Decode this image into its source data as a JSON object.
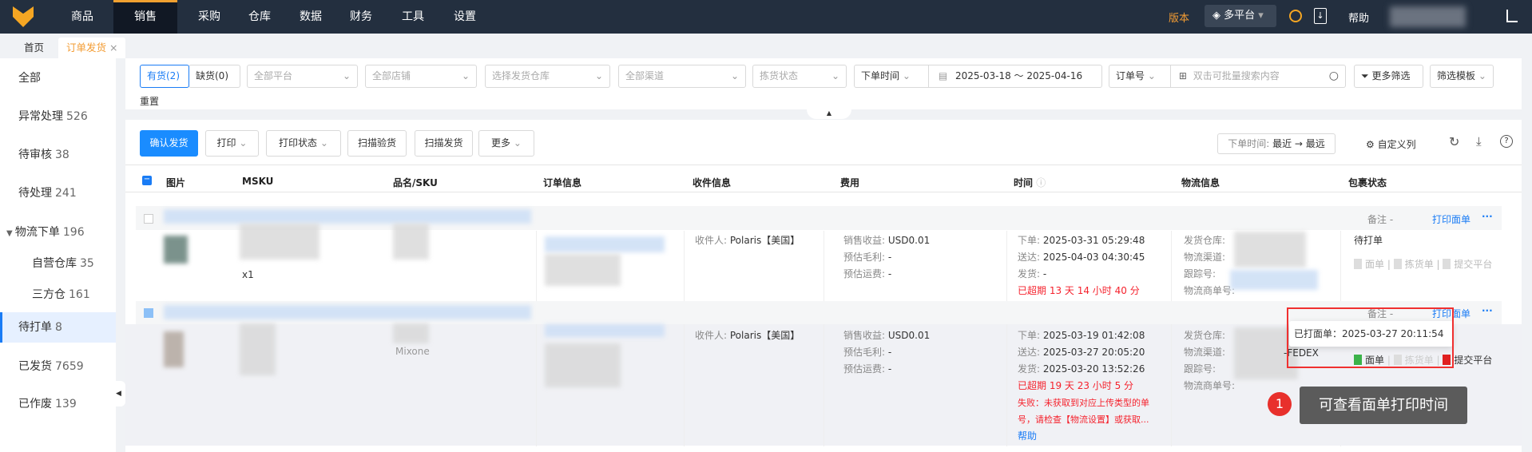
{
  "nav": {
    "items": [
      "商品",
      "销售",
      "采购",
      "仓库",
      "数据",
      "财务",
      "工具",
      "设置"
    ],
    "active": "销售",
    "version": "版本",
    "platform": "多平台",
    "help": "帮助"
  },
  "tabs": {
    "home": "首页",
    "current": "订单发货",
    "close": "×"
  },
  "sidebar": [
    {
      "label": "全部",
      "count": ""
    },
    {
      "label": "异常处理",
      "count": "526"
    },
    {
      "label": "待审核",
      "count": "38"
    },
    {
      "label": "待处理",
      "count": "241"
    },
    {
      "label": "物流下单",
      "count": "196"
    },
    {
      "label": "自营仓库",
      "count": "35"
    },
    {
      "label": "三方仓",
      "count": "161"
    },
    {
      "label": "待打单",
      "count": "8"
    },
    {
      "label": "已发货",
      "count": "7659"
    },
    {
      "label": "已作废",
      "count": "139"
    }
  ],
  "filters": {
    "in_stock": "有货(2)",
    "out_stock": "缺货(0)",
    "platform": "全部平台",
    "shop": "全部店铺",
    "warehouse": "选择发货仓库",
    "channel": "全部渠道",
    "pick_status": "拣货状态",
    "time_type": "下单时间",
    "date_range": "2025-03-18 ～ 2025-04-16",
    "search_type": "订单号",
    "search_placeholder": "双击可批量搜索内容",
    "more": "更多筛选",
    "template": "筛选模板",
    "reset": "重置"
  },
  "toolbar": {
    "confirm": "确认发货",
    "print": "打印",
    "print_status": "打印状态",
    "scan_check": "扫描验货",
    "scan_ship": "扫描发货",
    "more": "更多",
    "sort_label": "下单时间:",
    "sort_value": "最近 → 最远",
    "custom_cols": "自定义列"
  },
  "columns": [
    "图片",
    "MSKU",
    "品名/SKU",
    "订单信息",
    "收件信息",
    "费用",
    "时间",
    "物流信息",
    "包裹状态"
  ],
  "labels": {
    "remark": "备注 -",
    "print_label": "打印面单",
    "more": "···",
    "recipient": "收件人:",
    "revenue": "销售收益:",
    "profit": "预估毛利:",
    "freight": "预估运费:",
    "order": "下单:",
    "delivered": "送达:",
    "shipped": "发货:",
    "wh": "发货仓库:",
    "channel": "物流渠道:",
    "tracking": "跟踪号:",
    "carrier_no": "物流商单号:",
    "a_label": "面单",
    "a_pick": "拣货单",
    "a_submit": "提交平台"
  },
  "rows": [
    {
      "qty": "x1",
      "recipient": "Polaris【美国】",
      "revenue": "USD0.01",
      "profit": "-",
      "freight": "-",
      "order": "2025-03-31 05:29:48",
      "delivered": "2025-04-03 04:30:45",
      "shipped": "-",
      "overdue": "已超期 13 天 14 小时 40 分",
      "status": "待打单"
    },
    {
      "product": "Mixone",
      "recipient": "Polaris【美国】",
      "revenue": "USD0.01",
      "profit": "-",
      "freight": "-",
      "order": "2025-03-19 01:42:08",
      "delivered": "2025-03-27 20:05:20",
      "shipped": "2025-03-20 13:52:26",
      "overdue": "已超期 19 天 23 小时 5 分",
      "error": "失败：未获取到对应上传类型的单号，请检查【物流设置】或获取...",
      "help": "帮助",
      "channel_tail": "-FEDEX"
    }
  ],
  "tooltip": {
    "text": "已打面单：2025-03-27 20:11:54"
  },
  "annotation": {
    "number": "1",
    "text": "可查看面单打印时间"
  }
}
